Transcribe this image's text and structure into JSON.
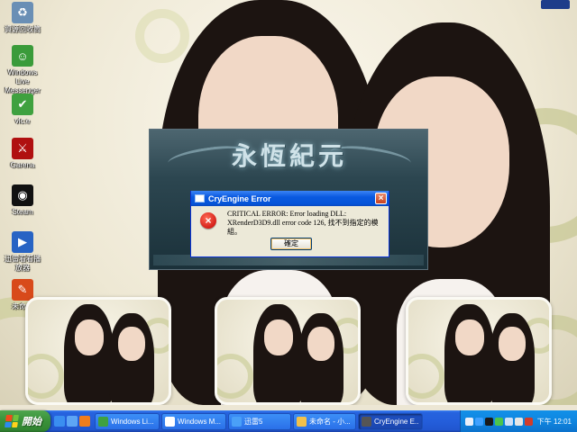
{
  "desktop": {
    "icons": [
      {
        "label": "資源回收筒",
        "icon": "recycle-bin-icon",
        "color": "#6a8fb5"
      },
      {
        "label": "Windows Live Messenger",
        "icon": "messenger-icon",
        "color": "#3a9b3a"
      },
      {
        "label": "vlc.e",
        "icon": "checkmark-icon",
        "color": "#3fa13f"
      },
      {
        "label": "Garena",
        "icon": "garena-icon",
        "color": "#b01010"
      },
      {
        "label": "Steam",
        "icon": "steam-icon",
        "color": "#111111"
      },
      {
        "label": "迅雷看看播放器",
        "icon": "player-icon",
        "color": "#2763c4"
      },
      {
        "label": "未命名",
        "icon": "paint-icon",
        "color": "#d84a1b"
      }
    ]
  },
  "launcher": {
    "logo_text": "永恆紀元"
  },
  "dialog": {
    "title": "CryEngine Error",
    "close_glyph": "×",
    "error_glyph": "×",
    "message": "CRITICAL ERROR: Error loading DLL: XRenderD3D9.dll error code 126, 找不到指定的模組。",
    "ok_label": "確定"
  },
  "taskbar": {
    "start_label": "開始",
    "start_logo_colors": [
      "#f04b1c",
      "#6fc33a",
      "#2d8bf0",
      "#ffd21c"
    ],
    "quick_launch": [
      {
        "icon": "ie-icon",
        "color": "#3a8ef0"
      },
      {
        "icon": "show-desktop-icon",
        "color": "#5da5f5"
      },
      {
        "icon": "media-player-icon",
        "color": "#f07d1c"
      }
    ],
    "tasks": [
      {
        "label": "Windows Li...",
        "icon": "messenger-icon",
        "color": "#3fa13f",
        "active": false
      },
      {
        "label": "Windows M...",
        "icon": "media-player-icon",
        "color": "#ffffff",
        "active": false
      },
      {
        "label": "迅雷5",
        "icon": "thunder-icon",
        "color": "#4aa0f8",
        "active": false
      },
      {
        "label": "未命名 - 小...",
        "icon": "paint-icon",
        "color": "#f2c14a",
        "active": false
      },
      {
        "label": "CryEngine E...",
        "icon": "cryengine-icon",
        "color": "#555555",
        "active": true
      }
    ],
    "tray_icons": [
      {
        "icon": "help-icon",
        "color": "#e9eff9"
      },
      {
        "icon": "thunder-tray-icon",
        "color": "#3fa1ff"
      },
      {
        "icon": "steam-tray-icon",
        "color": "#1a1a1a"
      },
      {
        "icon": "messenger-tray-icon",
        "color": "#4cc44c"
      },
      {
        "icon": "network-icon",
        "color": "#cfe0f7"
      },
      {
        "icon": "volume-icon",
        "color": "#e6e6e6"
      },
      {
        "icon": "security-icon",
        "color": "#d23c2a"
      }
    ],
    "clock": "下午 12:01"
  }
}
